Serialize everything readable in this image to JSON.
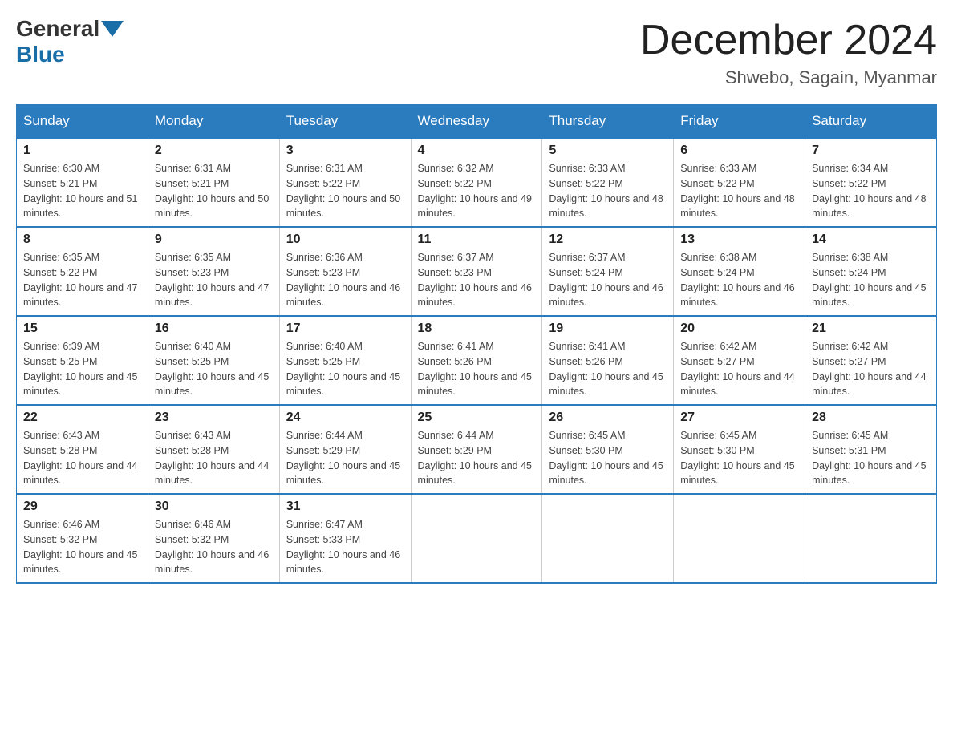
{
  "header": {
    "logo_general": "General",
    "logo_blue": "Blue",
    "month_title": "December 2024",
    "location": "Shwebo, Sagain, Myanmar"
  },
  "weekdays": [
    "Sunday",
    "Monday",
    "Tuesday",
    "Wednesday",
    "Thursday",
    "Friday",
    "Saturday"
  ],
  "weeks": [
    [
      {
        "day": "1",
        "sunrise": "6:30 AM",
        "sunset": "5:21 PM",
        "daylight": "10 hours and 51 minutes."
      },
      {
        "day": "2",
        "sunrise": "6:31 AM",
        "sunset": "5:21 PM",
        "daylight": "10 hours and 50 minutes."
      },
      {
        "day": "3",
        "sunrise": "6:31 AM",
        "sunset": "5:22 PM",
        "daylight": "10 hours and 50 minutes."
      },
      {
        "day": "4",
        "sunrise": "6:32 AM",
        "sunset": "5:22 PM",
        "daylight": "10 hours and 49 minutes."
      },
      {
        "day": "5",
        "sunrise": "6:33 AM",
        "sunset": "5:22 PM",
        "daylight": "10 hours and 48 minutes."
      },
      {
        "day": "6",
        "sunrise": "6:33 AM",
        "sunset": "5:22 PM",
        "daylight": "10 hours and 48 minutes."
      },
      {
        "day": "7",
        "sunrise": "6:34 AM",
        "sunset": "5:22 PM",
        "daylight": "10 hours and 48 minutes."
      }
    ],
    [
      {
        "day": "8",
        "sunrise": "6:35 AM",
        "sunset": "5:22 PM",
        "daylight": "10 hours and 47 minutes."
      },
      {
        "day": "9",
        "sunrise": "6:35 AM",
        "sunset": "5:23 PM",
        "daylight": "10 hours and 47 minutes."
      },
      {
        "day": "10",
        "sunrise": "6:36 AM",
        "sunset": "5:23 PM",
        "daylight": "10 hours and 46 minutes."
      },
      {
        "day": "11",
        "sunrise": "6:37 AM",
        "sunset": "5:23 PM",
        "daylight": "10 hours and 46 minutes."
      },
      {
        "day": "12",
        "sunrise": "6:37 AM",
        "sunset": "5:24 PM",
        "daylight": "10 hours and 46 minutes."
      },
      {
        "day": "13",
        "sunrise": "6:38 AM",
        "sunset": "5:24 PM",
        "daylight": "10 hours and 46 minutes."
      },
      {
        "day": "14",
        "sunrise": "6:38 AM",
        "sunset": "5:24 PM",
        "daylight": "10 hours and 45 minutes."
      }
    ],
    [
      {
        "day": "15",
        "sunrise": "6:39 AM",
        "sunset": "5:25 PM",
        "daylight": "10 hours and 45 minutes."
      },
      {
        "day": "16",
        "sunrise": "6:40 AM",
        "sunset": "5:25 PM",
        "daylight": "10 hours and 45 minutes."
      },
      {
        "day": "17",
        "sunrise": "6:40 AM",
        "sunset": "5:25 PM",
        "daylight": "10 hours and 45 minutes."
      },
      {
        "day": "18",
        "sunrise": "6:41 AM",
        "sunset": "5:26 PM",
        "daylight": "10 hours and 45 minutes."
      },
      {
        "day": "19",
        "sunrise": "6:41 AM",
        "sunset": "5:26 PM",
        "daylight": "10 hours and 45 minutes."
      },
      {
        "day": "20",
        "sunrise": "6:42 AM",
        "sunset": "5:27 PM",
        "daylight": "10 hours and 44 minutes."
      },
      {
        "day": "21",
        "sunrise": "6:42 AM",
        "sunset": "5:27 PM",
        "daylight": "10 hours and 44 minutes."
      }
    ],
    [
      {
        "day": "22",
        "sunrise": "6:43 AM",
        "sunset": "5:28 PM",
        "daylight": "10 hours and 44 minutes."
      },
      {
        "day": "23",
        "sunrise": "6:43 AM",
        "sunset": "5:28 PM",
        "daylight": "10 hours and 44 minutes."
      },
      {
        "day": "24",
        "sunrise": "6:44 AM",
        "sunset": "5:29 PM",
        "daylight": "10 hours and 45 minutes."
      },
      {
        "day": "25",
        "sunrise": "6:44 AM",
        "sunset": "5:29 PM",
        "daylight": "10 hours and 45 minutes."
      },
      {
        "day": "26",
        "sunrise": "6:45 AM",
        "sunset": "5:30 PM",
        "daylight": "10 hours and 45 minutes."
      },
      {
        "day": "27",
        "sunrise": "6:45 AM",
        "sunset": "5:30 PM",
        "daylight": "10 hours and 45 minutes."
      },
      {
        "day": "28",
        "sunrise": "6:45 AM",
        "sunset": "5:31 PM",
        "daylight": "10 hours and 45 minutes."
      }
    ],
    [
      {
        "day": "29",
        "sunrise": "6:46 AM",
        "sunset": "5:32 PM",
        "daylight": "10 hours and 45 minutes."
      },
      {
        "day": "30",
        "sunrise": "6:46 AM",
        "sunset": "5:32 PM",
        "daylight": "10 hours and 46 minutes."
      },
      {
        "day": "31",
        "sunrise": "6:47 AM",
        "sunset": "5:33 PM",
        "daylight": "10 hours and 46 minutes."
      },
      null,
      null,
      null,
      null
    ]
  ]
}
